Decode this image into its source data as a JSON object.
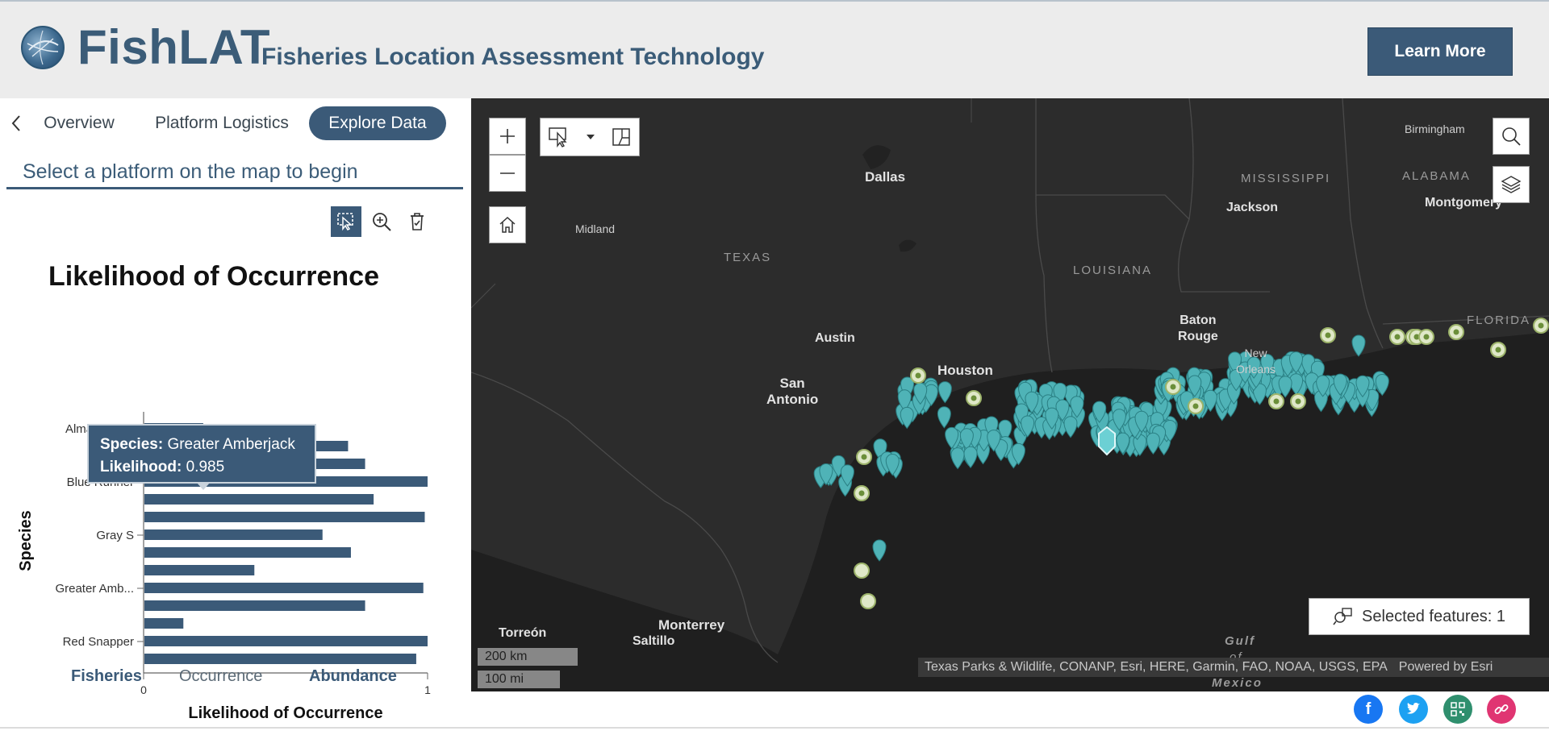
{
  "header": {
    "title": "FishLAT",
    "subtitle": "Fisheries Location Assessment Technology",
    "learn_more": "Learn More"
  },
  "panel": {
    "tabs": [
      {
        "label": "Overview",
        "active": false
      },
      {
        "label": "Platform Logistics",
        "active": false
      },
      {
        "label": "Explore Data",
        "active": true
      }
    ],
    "prompt": "Select a platform on the map to begin",
    "tools": [
      "select-icon",
      "zoom-in-icon",
      "clear-selection-icon"
    ],
    "bottom_tabs": [
      {
        "label": "Fisheries"
      },
      {
        "label": "Occurrence"
      },
      {
        "label": "Abundance"
      }
    ]
  },
  "tooltip": {
    "species_label": "Species:",
    "species_value": "Greater Amberjack",
    "likelihood_label": "Likelihood:",
    "likelihood_value": "0.985"
  },
  "chart_data": {
    "type": "bar",
    "orientation": "horizontal",
    "title": "Likelihood of Occurrence",
    "xlabel": "Likelihood of Occurrence",
    "ylabel": "Species",
    "xlim": [
      0,
      1
    ],
    "xticks": [
      "0",
      "1"
    ],
    "tick_labels": [
      "Almaco Jack",
      "Blue Runner",
      "Gray S",
      "Greater Amb...",
      "Red Snapper"
    ],
    "values": [
      0.21,
      0.72,
      0.78,
      1.0,
      0.81,
      0.99,
      0.63,
      0.73,
      0.39,
      0.985,
      0.78,
      0.14,
      1.0,
      0.96
    ],
    "bar_color": "#3b5a78"
  },
  "map": {
    "labels": {
      "dallas": "Dallas",
      "midland": "Midland",
      "texas": "TEXAS",
      "louisiana": "LOUISIANA",
      "mississippi": "MISSISSIPPI",
      "alabama": "ALABAMA",
      "jackson": "Jackson",
      "birmingham": "Birmingham",
      "montgomery": "Montgomery",
      "florida": "FLORIDA",
      "austin": "Austin",
      "san_antonio_1": "San",
      "san_antonio_2": "Antonio",
      "houston": "Houston",
      "baton_rouge_1": "Baton",
      "baton_rouge_2": "Rouge",
      "new_orleans_1": "New",
      "new_orleans_2": "Orleans",
      "torreon": "Torreón",
      "monterrey": "Monterrey",
      "saltillo": "Saltillo",
      "gulf": "Gulf",
      "of": "of",
      "mexico": "Mexico"
    },
    "selected_features": "Selected features: 1",
    "scale_km": "200 km",
    "scale_mi": "100 mi",
    "attribution": "Texas Parks & Wildlife, CONANP, Esri, HERE, Garmin, FAO, NOAA, USGS, EPA",
    "powered_by": "Powered by Esri",
    "platform_color": "#4fb3b7",
    "water_color": "#1f1f1f",
    "land_color": "#2e2e2e"
  },
  "social": [
    "facebook-icon",
    "twitter-icon",
    "qr-code-icon",
    "link-icon"
  ]
}
